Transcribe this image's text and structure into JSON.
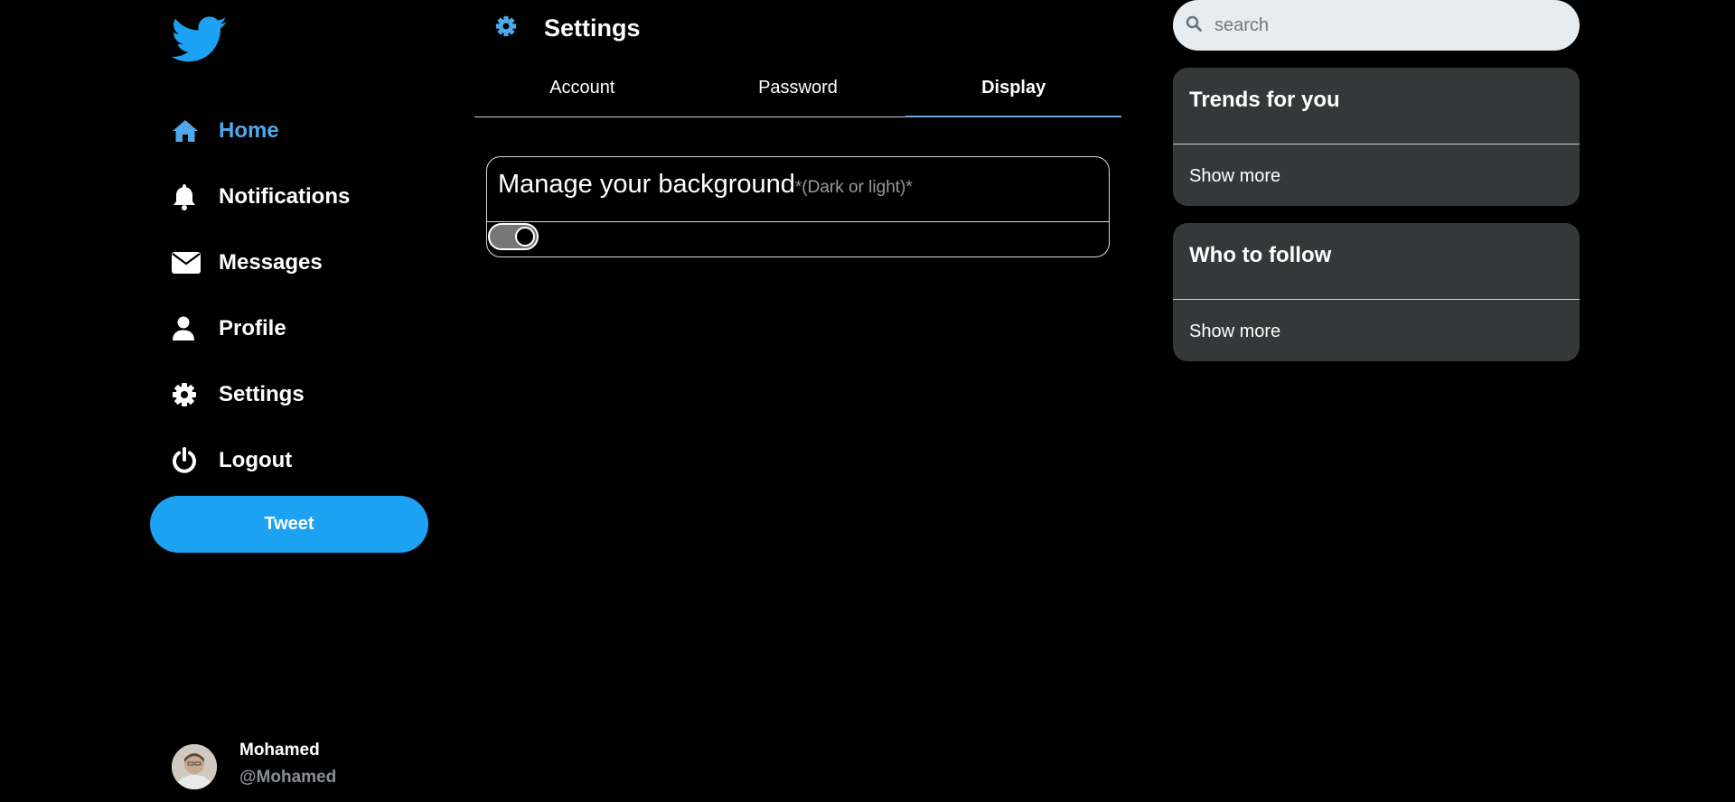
{
  "app": {
    "logo_icon": "twitter-bird-icon",
    "accent_color": "#1da1f2",
    "active_nav_color": "#4ea8ec"
  },
  "nav": {
    "items": [
      {
        "label": "Home",
        "icon": "home-icon",
        "active": true
      },
      {
        "label": "Notifications",
        "icon": "bell-icon",
        "active": false
      },
      {
        "label": "Messages",
        "icon": "envelope-icon",
        "active": false
      },
      {
        "label": "Profile",
        "icon": "user-icon",
        "active": false
      },
      {
        "label": "Settings",
        "icon": "gear-icon",
        "active": false
      },
      {
        "label": "Logout",
        "icon": "power-icon",
        "active": false
      }
    ],
    "tweet_label": "Tweet"
  },
  "user": {
    "name": "Mohamed",
    "handle": "@Mohamed"
  },
  "settings": {
    "title": "Settings",
    "tabs": [
      {
        "label": "Account",
        "active": false
      },
      {
        "label": "Password",
        "active": false
      },
      {
        "label": "Display",
        "active": true
      }
    ],
    "background_card": {
      "title": "Manage your background",
      "hint": "*(Dark or light)*",
      "toggle_on": true
    }
  },
  "search": {
    "placeholder": "search"
  },
  "trends": {
    "title": "Trends for you",
    "more_label": "Show more"
  },
  "follow": {
    "title": "Who to follow",
    "more_label": "Show more"
  }
}
